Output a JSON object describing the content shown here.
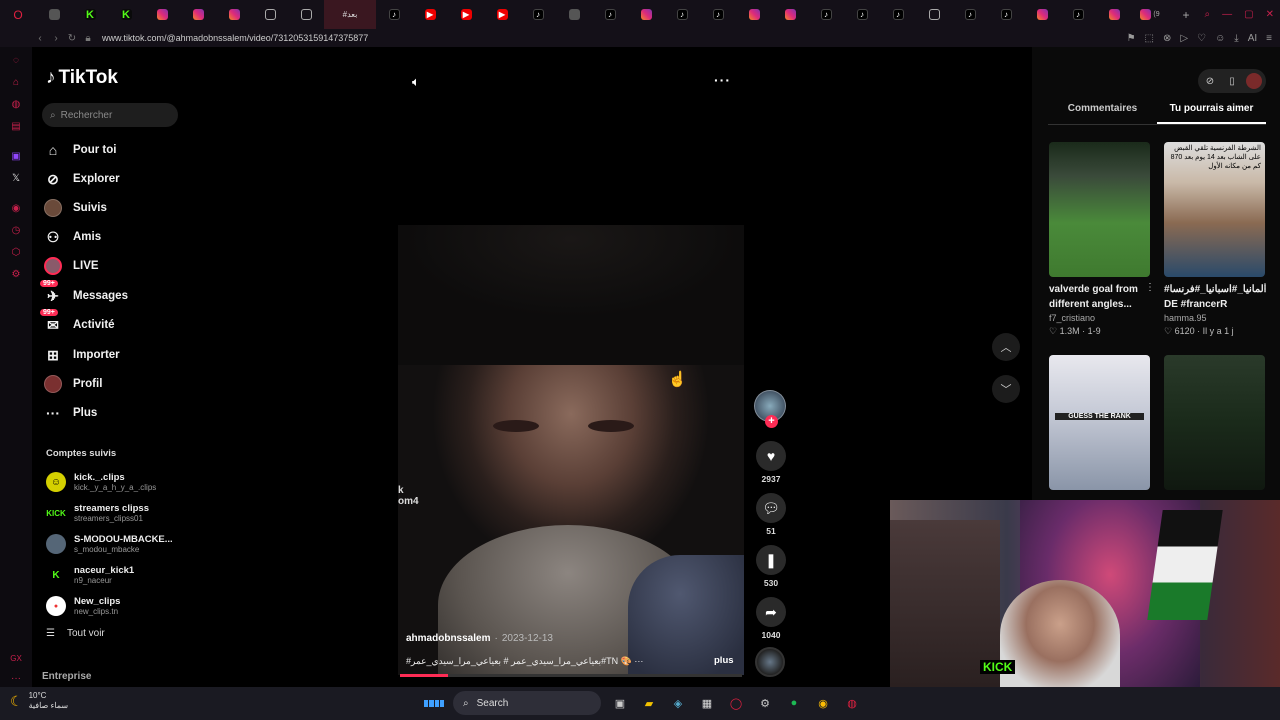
{
  "browser": {
    "url": "www.tiktok.com/@ahmadobnssalem/video/7312053159147375877",
    "active_tab_label": "#بعد",
    "tab_count_badge": "(9"
  },
  "tiktok": {
    "logo": "TikTok",
    "search_placeholder": "Rechercher",
    "nav": [
      {
        "label": "Pour toi",
        "icon": "home-icon"
      },
      {
        "label": "Explorer",
        "icon": "compass-icon"
      },
      {
        "label": "Suivis",
        "icon": "following-avatar-icon"
      },
      {
        "label": "Amis",
        "icon": "friends-icon"
      },
      {
        "label": "LIVE",
        "icon": "live-icon"
      },
      {
        "label": "Messages",
        "icon": "messages-icon",
        "badge": "99+"
      },
      {
        "label": "Activité",
        "icon": "activity-icon",
        "badge": "99+"
      },
      {
        "label": "Importer",
        "icon": "upload-icon"
      },
      {
        "label": "Profil",
        "icon": "profile-icon"
      },
      {
        "label": "Plus",
        "icon": "more-icon"
      }
    ],
    "followed_title": "Comptes suivis",
    "followed": [
      {
        "name": "kick._.clips",
        "handle": "kick._y_a_h_y_a_.clips",
        "color": "#d4d000"
      },
      {
        "name": "streamers clipss",
        "handle": "streamers_clipss01",
        "color": "#53fc18"
      },
      {
        "name": "S-MODOU-MBACKE...",
        "handle": "s_modou_mbacke",
        "color": "#556677"
      },
      {
        "name": "naceur_kick1",
        "handle": "n9_naceur",
        "color": "#53fc18"
      },
      {
        "name": "New_clips",
        "handle": "new_clips.tn",
        "color": "#e33"
      }
    ],
    "see_all": "Tout voir",
    "company": "Entreprise"
  },
  "video": {
    "author": "ahmadobnssalem",
    "date": "2023-12-13",
    "caption": "#بعياعي_مرا_سيدي_عمر # بعياعي_مرا_سيدي_عمر#TN 🎨 ···",
    "more": "plus",
    "watermark_line1": "k",
    "watermark_line2": "om4",
    "progress": 0.14,
    "likes": "2937",
    "comments": "51",
    "saves": "530",
    "shares": "1040"
  },
  "right_panel": {
    "tabs": [
      "Commentaires",
      "Tu pourrais aimer"
    ],
    "active_tab": "Tu pourrais aimer",
    "recs": [
      {
        "title": "valverde goal from different angles...",
        "author": "f7_cristiano",
        "stats": "1.3M · 1-9"
      },
      {
        "title": "#المانيا_#اسبانيا_#فرنسا DE #francerR",
        "author": "hamma.95",
        "stats": "6120 · Il y a 1 j"
      }
    ],
    "thumb2_text": "الشرطة الفرنسية تلقي القبض على الشاب بعد 14 يوم بعد 870 كم من مكانه الأول",
    "thumb3_text": "GUESS THE RANK"
  },
  "taskbar": {
    "temp": "10°C",
    "weather_desc": "سماء صافية",
    "search_label": "Search"
  }
}
